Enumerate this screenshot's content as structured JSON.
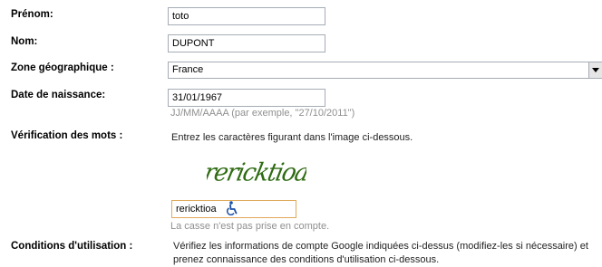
{
  "form": {
    "prenom": {
      "label": "Prénom:",
      "value": "toto"
    },
    "nom": {
      "label": "Nom:",
      "value": "DUPONT"
    },
    "zone": {
      "label": "Zone géographique :",
      "value": "France"
    },
    "naissance": {
      "label": "Date de naissance:",
      "value": "31/01/1967",
      "hint": "JJ/MM/AAAA (par exemple, \"27/10/2011\")"
    },
    "verification": {
      "label": "Vérification des mots :",
      "instruction": "Entrez les caractères figurant dans l'image ci-dessous.",
      "captcha_text": "rericktioa",
      "value": "rericktioa",
      "hint": "La casse n'est pas prise en compte.",
      "accessibility_icon": "wheelchair-icon"
    },
    "conditions": {
      "label": "Conditions d'utilisation :",
      "line1": "Vérifiez les informations de compte Google indiquées ci-dessus (modifiez-les si nécessaire) et",
      "line2": "prenez connaissance des conditions d'utilisation ci-dessous."
    }
  },
  "colors": {
    "input_border": "#a5acb5",
    "focus_border": "#e0a95a",
    "hint": "#8f8f8f",
    "accent": "#1a4fa6"
  }
}
